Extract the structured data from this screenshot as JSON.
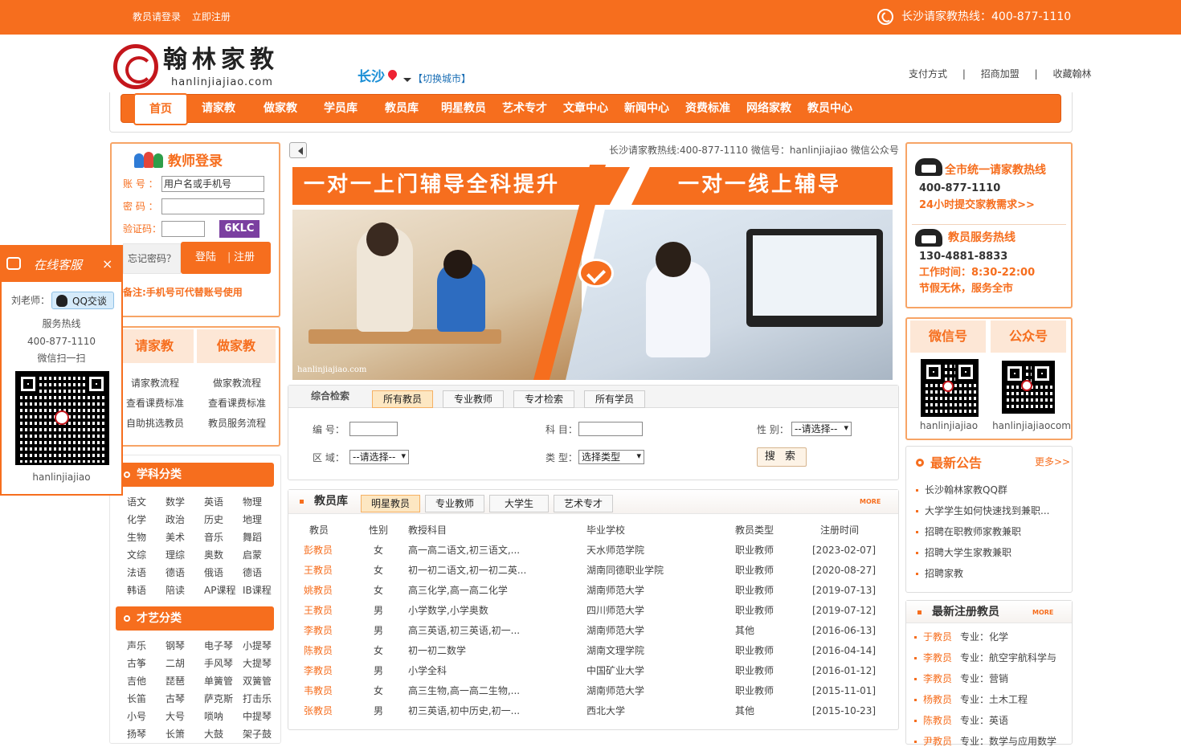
{
  "topbar": {
    "teacher_login": "教员请登录",
    "register": "立即注册",
    "hotline": "长沙请家教热线：400-877-1110"
  },
  "logo": {
    "name": "翰林家教",
    "url": "hanlinjiajiao.com"
  },
  "city": {
    "name": "长沙",
    "switch": "【切换城市】"
  },
  "toplinks": [
    "支付方式",
    "|",
    "招商加盟",
    "|",
    "收藏翰林"
  ],
  "nav": [
    "首页",
    "请家教",
    "做家教",
    "学员库",
    "教员库",
    "明星教员",
    "艺术专才",
    "文章中心",
    "新闻中心",
    "资费标准",
    "网络家教",
    "教员中心"
  ],
  "login": {
    "title": "教师登录",
    "account_label": "账 号 ：",
    "account_value": "用户名或手机号",
    "password_label": "密 码 ：",
    "captcha_label": "验证码：",
    "captcha": "6KLC",
    "forget": "忘记密码？",
    "login_btn": "登陆",
    "register_btn": "注册",
    "note": "备注:手机号可代替账号使用"
  },
  "hire": {
    "title": "请家教",
    "links": [
      "请家教流程",
      "查看课费标准",
      "自助挑选教员"
    ]
  },
  "tutor": {
    "title": "做家教",
    "links": [
      "做家教流程",
      "查看课费标准",
      "教员服务流程"
    ]
  },
  "subjects": {
    "title": "学科分类",
    "rows": [
      [
        "语文",
        "数学",
        "英语",
        "物理"
      ],
      [
        "化学",
        "政治",
        "历史",
        "地理"
      ],
      [
        "生物",
        "美术",
        "音乐",
        "舞蹈"
      ],
      [
        "文综",
        "理综",
        "奥数",
        "启蒙"
      ],
      [
        "法语",
        "德语",
        "俄语",
        "德语"
      ],
      [
        "韩语",
        "陪读",
        "AP课程",
        "IB课程"
      ]
    ]
  },
  "arts": {
    "title": "才艺分类",
    "rows": [
      [
        "声乐",
        "钢琴",
        "电子琴",
        "小提琴"
      ],
      [
        "古筝",
        "二胡",
        "手风琴",
        "大提琴"
      ],
      [
        "吉他",
        "琵琶",
        "单簧管",
        "双簧管"
      ],
      [
        "长笛",
        "古琴",
        "萨克斯",
        "打击乐"
      ],
      [
        "小号",
        "大号",
        "唢呐",
        "中提琴"
      ],
      [
        "扬琴",
        "长箫",
        "大鼓",
        "架子鼓"
      ]
    ]
  },
  "float_service": {
    "title": "在线客服",
    "close": "×",
    "teacher": "刘老师：",
    "qq": "QQ交谈",
    "hotline_label": "服务热线",
    "hotline": "400-877-1110",
    "scan": "微信扫一扫",
    "account": "hanlinjiajiao"
  },
  "marquee": "长沙请家教热线:400-877-1110 微信号：hanlinjiajiao 微信公众号",
  "banner": {
    "left": "一对一上门辅导全科提升",
    "right": "一对一线上辅导",
    "watermark": "hanlinjiajiao.com"
  },
  "search": {
    "tabs": [
      "综合检索",
      "所有教员",
      "专业教师",
      "专才检索",
      "所有学员"
    ],
    "fields": {
      "id": "编 号：",
      "subject": "科 目：",
      "gender": "性 别：",
      "area": "区 域：",
      "type": "类 型："
    },
    "gender_value": "--请选择--",
    "area_value": "--请选择--",
    "type_value": "选择类型",
    "button": "搜 索"
  },
  "teacher_library": {
    "title": "教员库",
    "tabs": [
      "明星教员",
      "专业教师",
      "大学生",
      "艺术专才"
    ],
    "more": "MORE",
    "columns": [
      "教员",
      "性别",
      "教授科目",
      "毕业学校",
      "教员类型",
      "注册时间"
    ],
    "rows": [
      [
        "彭教员",
        "女",
        "高一高二语文,初三语文,...",
        "天水师范学院",
        "职业教师",
        "[2023-02-07]"
      ],
      [
        "王教员",
        "女",
        "初一初二语文,初一初二英...",
        "湖南同德职业学院",
        "职业教师",
        "[2020-08-27]"
      ],
      [
        "姚教员",
        "女",
        "高三化学,高一高二化学",
        "湖南师范大学",
        "职业教师",
        "[2019-07-13]"
      ],
      [
        "王教员",
        "男",
        "小学数学,小学奥数",
        "四川师范大学",
        "职业教师",
        "[2019-07-12]"
      ],
      [
        "李教员",
        "男",
        "高三英语,初三英语,初一...",
        "湖南师范大学",
        "其他",
        "[2016-06-13]"
      ],
      [
        "陈教员",
        "女",
        "初一初二数学",
        "湖南文理学院",
        "职业教师",
        "[2016-04-14]"
      ],
      [
        "李教员",
        "男",
        "小学全科",
        "中国矿业大学",
        "职业教师",
        "[2016-01-12]"
      ],
      [
        "韦教员",
        "女",
        "高三生物,高一高二生物,...",
        "湖南师范大学",
        "职业教师",
        "[2015-11-01]"
      ],
      [
        "张教员",
        "男",
        "初三英语,初中历史,初一...",
        "西北大学",
        "其他",
        "[2015-10-23]"
      ]
    ]
  },
  "hotline_box": {
    "title1": "全市统一请家教热线",
    "number1": "400-877-1110",
    "cta": "24小时提交家教需求>>",
    "title2": "教员服务热线",
    "number2": "130-4881-8833",
    "hours": "工作时间：8:30-22:00",
    "holiday": "节假无休，服务全市"
  },
  "wechat_box": {
    "wx_title": "微信号",
    "gzh_title": "公众号",
    "wx_id": "hanlinjiajiao",
    "gzh_id": "hanlinjiajiaocom"
  },
  "announcements": {
    "title": "最新公告",
    "more": "更多>>",
    "items": [
      "长沙翰林家教QQ群",
      "大学学生如何快速找到兼职...",
      "招聘在职教师家教兼职",
      "招聘大学生家教兼职",
      "招聘家教"
    ]
  },
  "new_teachers": {
    "title": "最新注册教员",
    "more": "MORE",
    "items": [
      {
        "name": "于教员",
        "major": "专业：化学"
      },
      {
        "name": "李教员",
        "major": "专业：航空宇航科学与"
      },
      {
        "name": "李教员",
        "major": "专业：营销"
      },
      {
        "name": "杨教员",
        "major": "专业：土木工程"
      },
      {
        "name": "陈教员",
        "major": "专业：英语"
      },
      {
        "name": "尹教员",
        "major": "专业：数学与应用数学"
      }
    ]
  },
  "colors": {
    "brand": "#f66e1e",
    "link_blue": "#1b8fd6"
  }
}
